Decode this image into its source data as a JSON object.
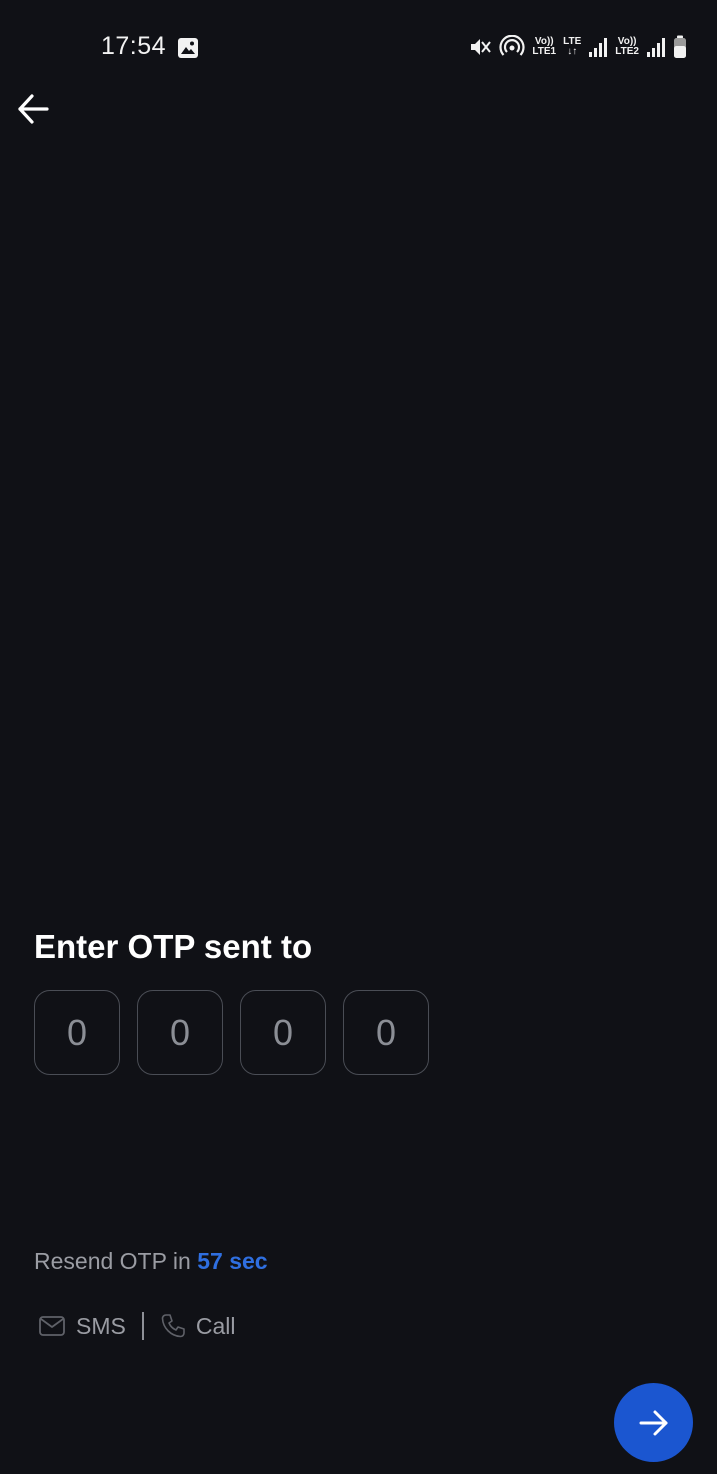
{
  "status_bar": {
    "time": "17:54",
    "net1_top": "Vo))",
    "net1_bottom": "LTE1",
    "net_mid_top": "LTE",
    "net2_top": "Vo))",
    "net2_bottom": "LTE2",
    "icons": [
      "gallery-icon",
      "mute-icon",
      "hotspot-icon",
      "signal-icon",
      "battery-icon"
    ]
  },
  "otp": {
    "title": "Enter OTP sent to",
    "digits": [
      "0",
      "0",
      "0",
      "0"
    ]
  },
  "resend": {
    "prefix": "Resend OTP in ",
    "timer": "57 sec"
  },
  "channels": {
    "sms_label": "SMS",
    "call_label": "Call"
  },
  "colors": {
    "background": "#101116",
    "accent": "#2f6fe0",
    "fab": "#1b56d0"
  }
}
